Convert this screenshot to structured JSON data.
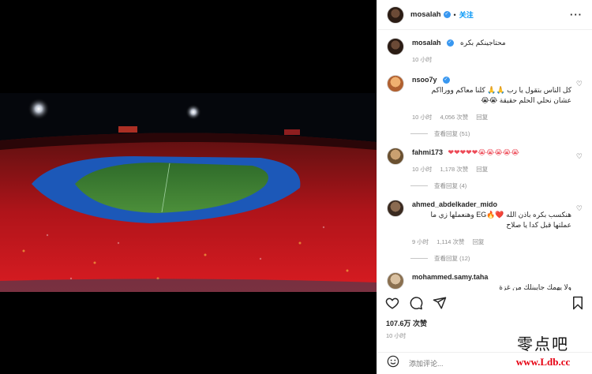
{
  "post": {
    "author": "mosalah",
    "follow_label": "关注",
    "more_icon": "more-horizontal-icon",
    "caption": "محتاجينكم بكره",
    "caption_time": "10 小时",
    "likes": "107.6万 次赞",
    "time": "10 小时",
    "add_comment_placeholder": "添加评论..."
  },
  "comments": [
    {
      "user": "nsoo7y",
      "text": "كل الناس بتقول يا رب 🙏🙏 كلنا معاكم وورااكم عشان نحلي الحلم حقيقة 😭😭",
      "time": "10 小时",
      "likes": "4,056 次赞",
      "reply": "回复",
      "view_replies": "查看回复 (51)"
    },
    {
      "user": "fahmi173",
      "text": "❤❤❤❤❤😭😭😭😭😭",
      "time": "10 小时",
      "likes": "1,178 次赞",
      "reply": "回复",
      "view_replies": "查看回复 (4)"
    },
    {
      "user": "ahmed_abdelkader_mido",
      "text": "هنكسب بكره باذن الله ❤️🔥EG وهنعملها زي ما عملتها قبل كدا يا صلاح",
      "time": "9 小时",
      "likes": "1,114 次赞",
      "reply": "回复",
      "view_replies": "查看回复 (12)"
    },
    {
      "user": "mohammed.samy.taha",
      "text": "ولا يهمك جايبنلك من غزة"
    }
  ],
  "watermark": {
    "title": "零点吧",
    "url": "www.Ldb.cc"
  },
  "colors": {
    "accent": "#0095f6",
    "verified": "#3897f0",
    "muted": "#8e8e8e",
    "heart": "#ed4956"
  }
}
